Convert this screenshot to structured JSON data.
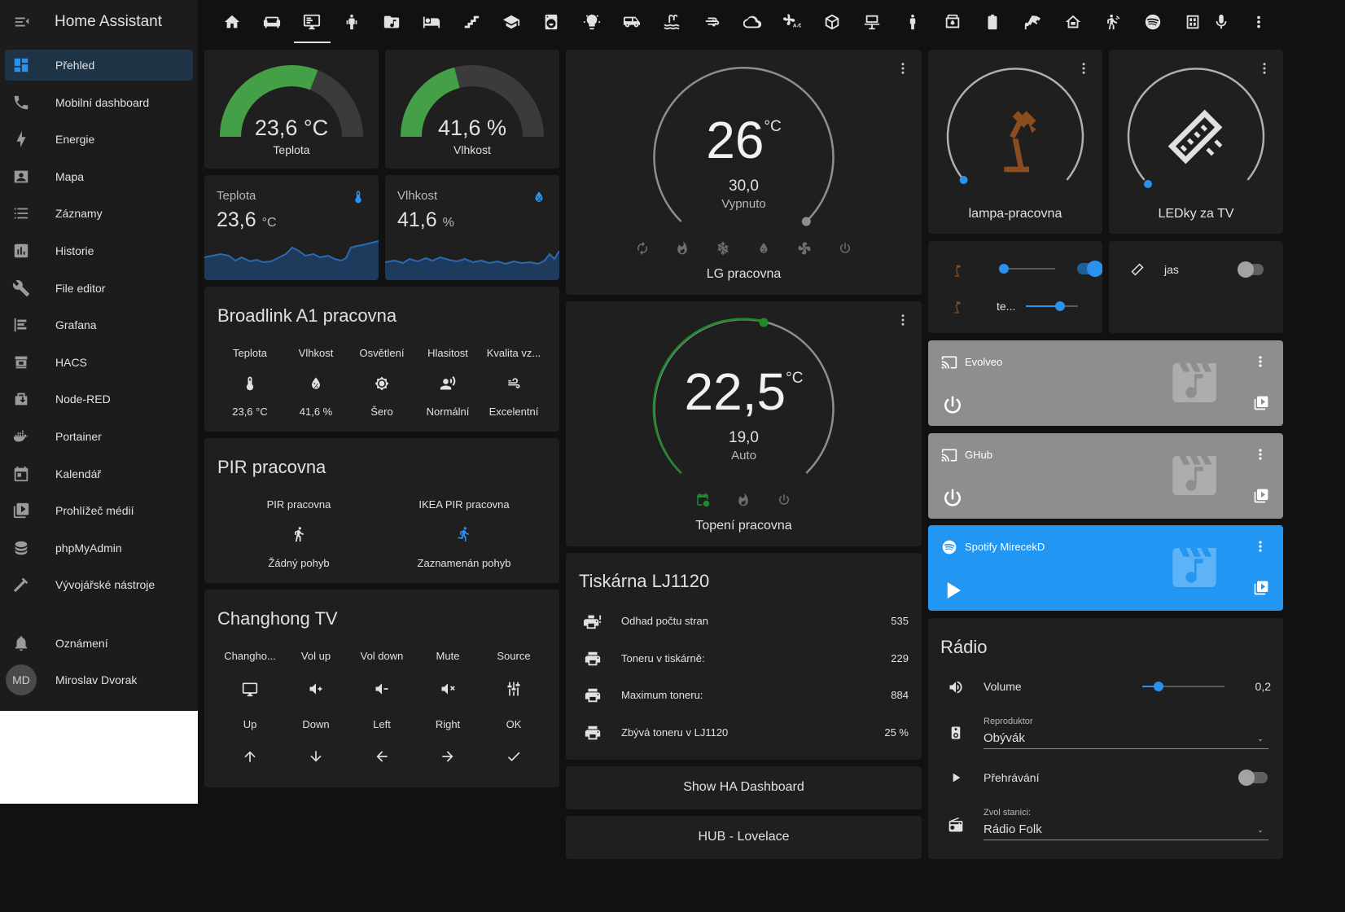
{
  "app": {
    "title": "Home Assistant"
  },
  "sidebar": {
    "items": [
      {
        "label": "Přehled",
        "icon": "view-dashboard-icon",
        "active": true
      },
      {
        "label": "Mobilní dashboard",
        "icon": "phone-icon"
      },
      {
        "label": "Energie",
        "icon": "lightning-icon"
      },
      {
        "label": "Mapa",
        "icon": "map-person-icon"
      },
      {
        "label": "Záznamy",
        "icon": "list-icon"
      },
      {
        "label": "Historie",
        "icon": "chart-box-icon"
      },
      {
        "label": "File editor",
        "icon": "wrench-icon"
      },
      {
        "label": "Grafana",
        "icon": "grafana-icon"
      },
      {
        "label": "HACS",
        "icon": "hacs-icon"
      },
      {
        "label": "Node-RED",
        "icon": "node-red-icon"
      },
      {
        "label": "Portainer",
        "icon": "docker-icon"
      },
      {
        "label": "Kalendář",
        "icon": "calendar-icon"
      },
      {
        "label": "Prohlížeč médií",
        "icon": "media-play-icon"
      },
      {
        "label": "phpMyAdmin",
        "icon": "database-icon"
      },
      {
        "label": "Vývojářské nástroje",
        "icon": "hammer-icon"
      }
    ],
    "notifications": "Oznámení",
    "user": {
      "initials": "MD",
      "name": "Miroslav Dvorak"
    }
  },
  "gauges": {
    "temperature": {
      "value": "23,6 °C",
      "label": "Teplota",
      "fraction": 0.62
    },
    "humidity": {
      "value": "41,6 %",
      "label": "Vlhkost",
      "fraction": 0.42
    }
  },
  "sensors": {
    "temperature": {
      "name": "Teplota",
      "value": "23,6",
      "unit": "°C"
    },
    "humidity": {
      "name": "Vlhkost",
      "value": "41,6",
      "unit": "%"
    }
  },
  "broadlink": {
    "title": "Broadlink A1 pracovna",
    "cols": [
      {
        "label": "Teplota",
        "state": "23,6 °C",
        "icon": "thermometer-icon"
      },
      {
        "label": "Vlhkost",
        "state": "41,6 %",
        "icon": "water-percent-icon"
      },
      {
        "label": "Osvětlení",
        "state": "Šero",
        "icon": "brightness-icon"
      },
      {
        "label": "Hlasitost",
        "state": "Normální",
        "icon": "voice-icon"
      },
      {
        "label": "Kvalita vz...",
        "state": "Excelentní",
        "icon": "air-icon"
      }
    ]
  },
  "pir": {
    "title": "PIR pracovna",
    "cols": [
      {
        "label": "PIR pracovna",
        "state": "Žádný pohyb"
      },
      {
        "label": "IKEA PIR pracovna",
        "state": "Zaznamenán pohyb"
      }
    ]
  },
  "tv": {
    "title": "Changhong TV",
    "row1": [
      "Changho...",
      "Vol up",
      "Vol down",
      "Mute",
      "Source"
    ],
    "row2": [
      "Up",
      "Down",
      "Left",
      "Right",
      "OK"
    ]
  },
  "climate_lg": {
    "target": "26",
    "unit": "°C",
    "current": "30,0",
    "state": "Vypnuto",
    "name": "LG pracovna"
  },
  "climate_heat": {
    "target": "22,5",
    "unit": "°C",
    "current": "19,0",
    "state": "Auto",
    "name": "Topení pracovna"
  },
  "printer": {
    "title": "Tiskárna LJ1120",
    "rows": [
      {
        "label": "Odhad počtu stran",
        "value": "535"
      },
      {
        "label": "Toneru v tiskárně:",
        "value": "229"
      },
      {
        "label": "Maximum toneru:",
        "value": "884"
      },
      {
        "label": "Zbývá toneru v LJ1120",
        "value": "25 %"
      }
    ]
  },
  "buttons": {
    "dashboard": "Show HA Dashboard",
    "hub": "HUB - Lovelace"
  },
  "lights": {
    "lamp": {
      "name": "lampa-pracovna"
    },
    "led": {
      "name": "LEDky za TV"
    }
  },
  "light_rows": {
    "row2_label": "te...",
    "jas_label": "jas"
  },
  "media": [
    {
      "name": "Evolveo"
    },
    {
      "name": "GHub"
    },
    {
      "name": "Spotify MirecekD"
    }
  ],
  "radio": {
    "title": "Rádio",
    "volume_label": "Volume",
    "volume_value": "0,2",
    "volume_fraction": 0.2,
    "speaker_label": "Reproduktor",
    "speaker_value": "Obývák",
    "playing_label": "Přehrávání",
    "station_label": "Zvol stanici:",
    "station_value": "Rádio Folk"
  },
  "colors": {
    "accent": "#2a91ec",
    "gauge_green": "#43a047",
    "spotify_blue": "#2196f3",
    "media_grey": "#8e8e8e"
  }
}
